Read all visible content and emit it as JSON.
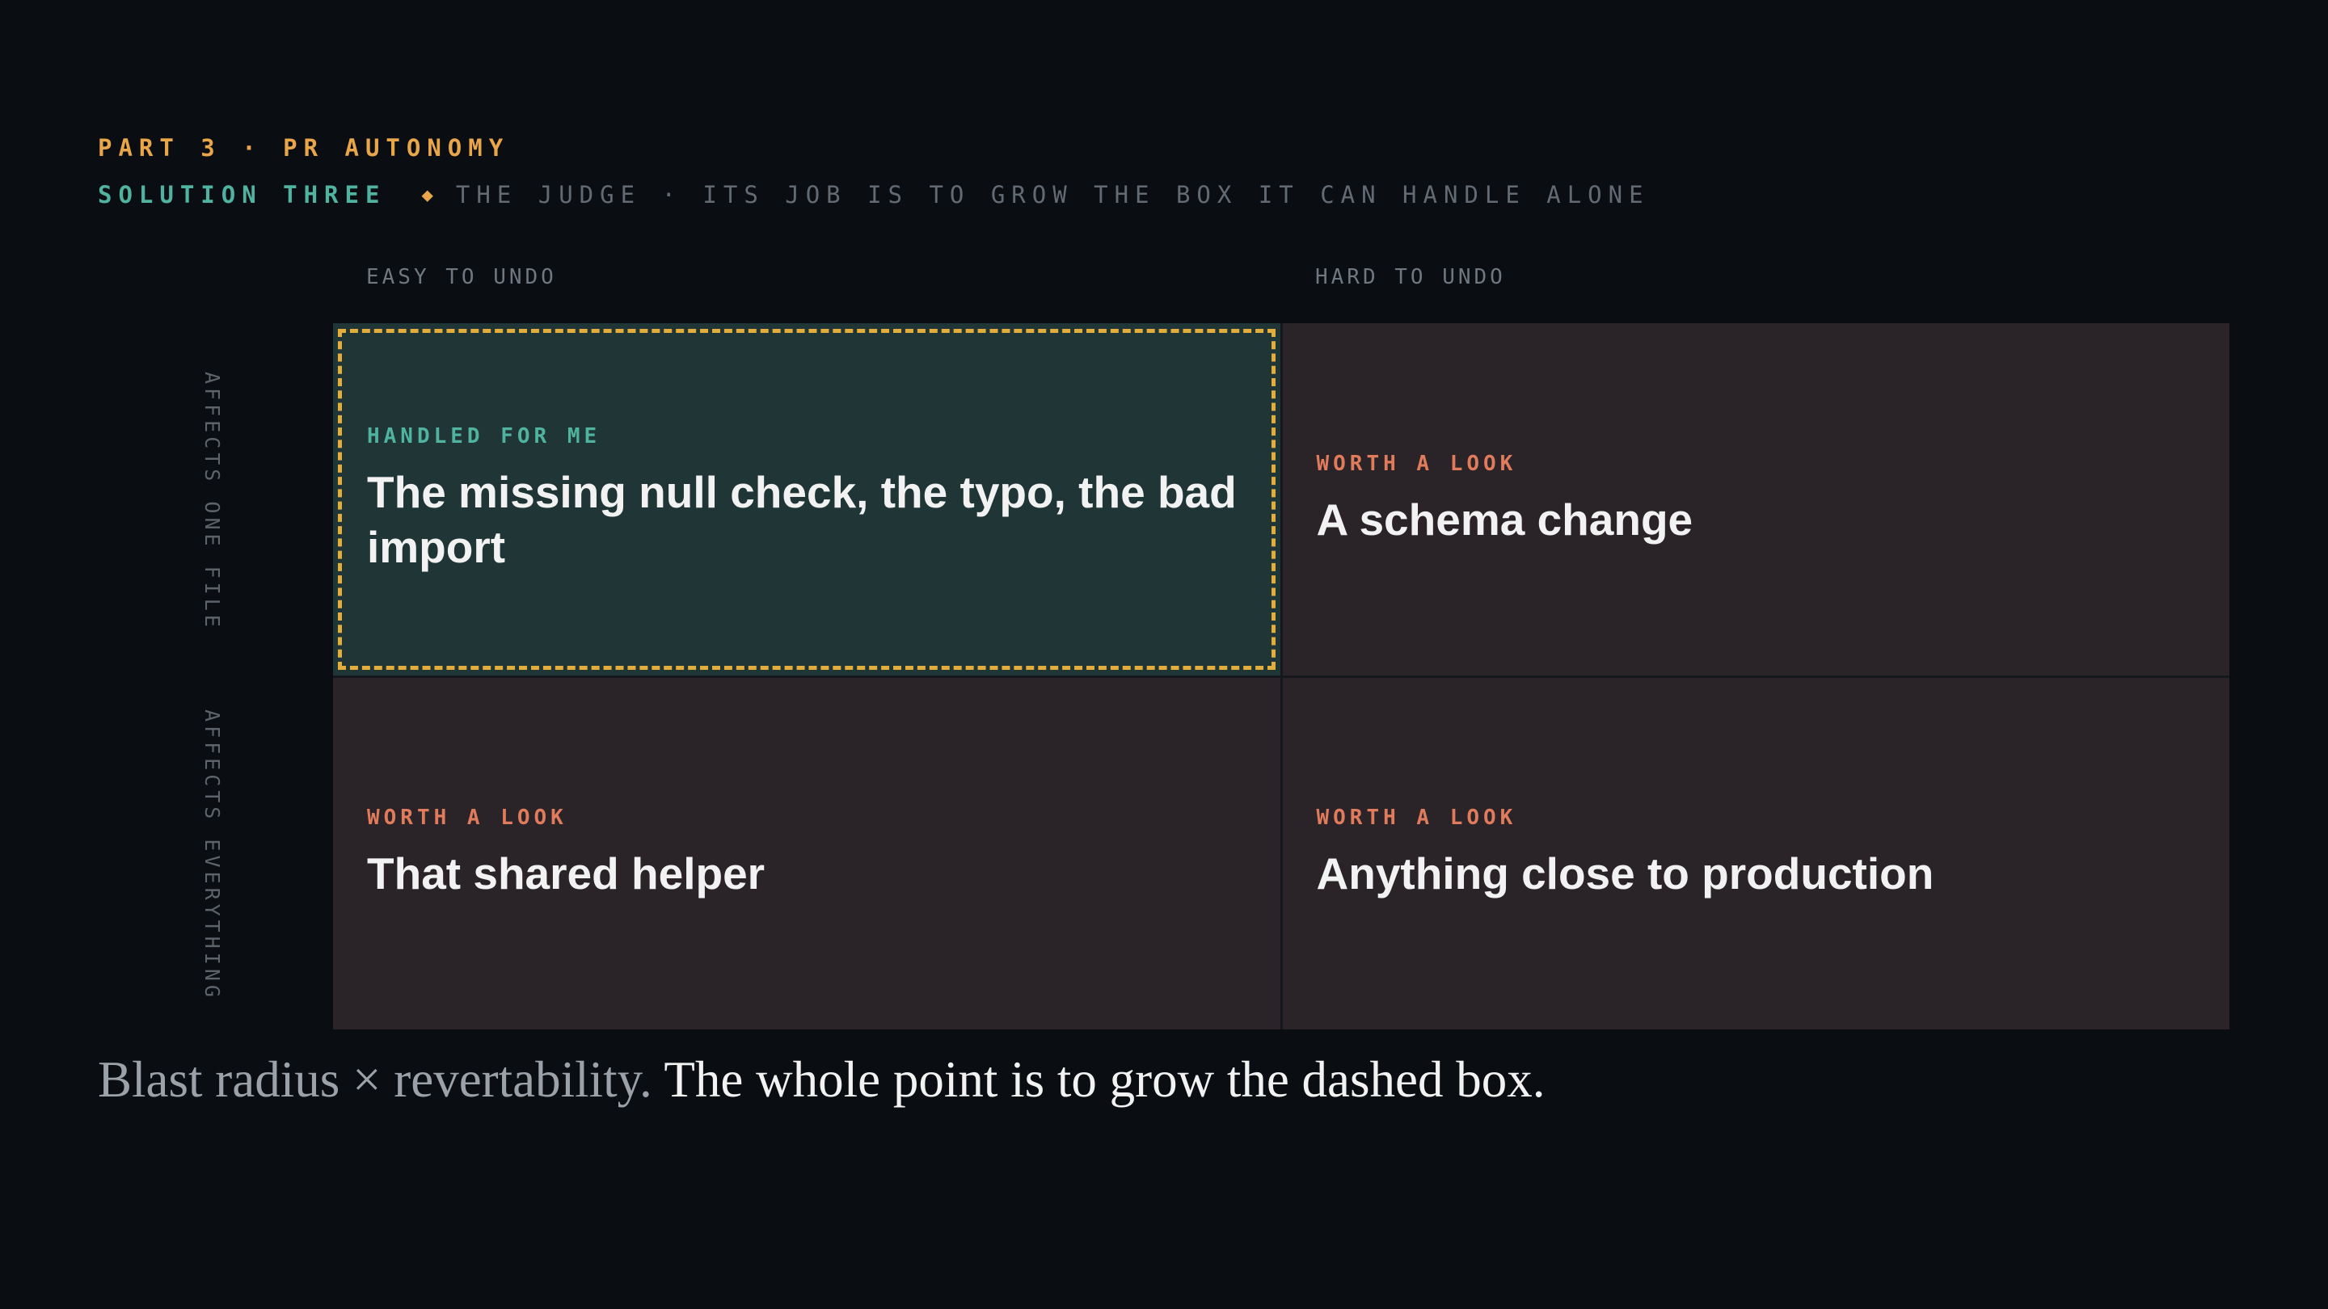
{
  "header": {
    "eyebrow": "PART 3 · PR AUTONOMY",
    "solution_label": "SOLUTION THREE",
    "separator": "◆",
    "judge_text": "THE JUDGE · ITS JOB IS TO GROW THE BOX IT CAN HANDLE ALONE"
  },
  "matrix": {
    "columns": [
      "EASY TO UNDO",
      "HARD TO UNDO"
    ],
    "rows": [
      "AFFECTS ONE FILE",
      "AFFECTS EVERYTHING"
    ],
    "cells": [
      {
        "tag": "HANDLED FOR ME",
        "text": "The missing null check, the typo, the bad import"
      },
      {
        "tag": "WORTH A LOOK",
        "text": "A schema change"
      },
      {
        "tag": "WORTH A LOOK",
        "text": "That shared helper"
      },
      {
        "tag": "WORTH A LOOK",
        "text": "Anything close to production"
      }
    ]
  },
  "caption": {
    "muted": "Blast radius × revertability.",
    "bright": "The whole point is to grow the dashed box."
  },
  "colors": {
    "background": "#0a0d11",
    "accent_orange": "#e8a54a",
    "accent_teal": "#4fb3a0",
    "accent_red": "#e07b5c",
    "cell_green": "#1f3536",
    "cell_dark": "#2a2428",
    "dashed_border": "#e3ad3c"
  }
}
